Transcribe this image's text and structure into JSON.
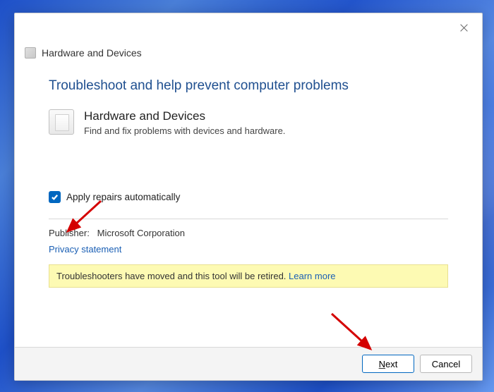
{
  "window": {
    "title": "Hardware and Devices"
  },
  "heading": "Troubleshoot and help prevent computer problems",
  "device": {
    "title": "Hardware and Devices",
    "desc": "Find and fix problems with devices and hardware."
  },
  "checkbox": {
    "label": "Apply repairs automatically",
    "checked": true
  },
  "publisher": {
    "label": "Publisher:",
    "value": "Microsoft Corporation"
  },
  "privacy_link": "Privacy statement",
  "notice": {
    "text": "Troubleshooters have moved and this tool will be retired. ",
    "link": "Learn more"
  },
  "buttons": {
    "next": "Next",
    "cancel": "Cancel"
  }
}
